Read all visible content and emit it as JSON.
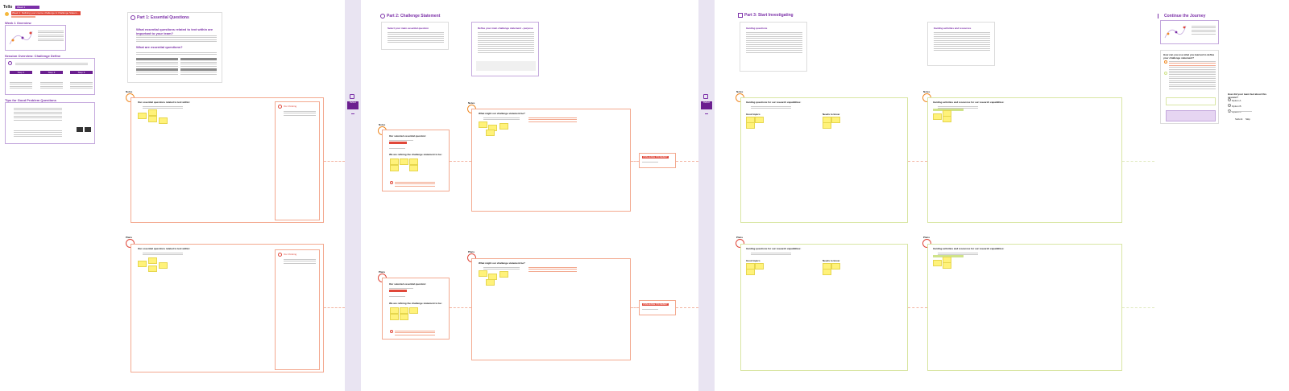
{
  "header": {
    "brand": "Tello",
    "badge": "Week 1",
    "banner": "Week 1: Defining your course challenge & Challenge Statem..."
  },
  "left_panel": {
    "overview_title": "Week 1 Overview",
    "session_title": "Session Overview: Challenge Define",
    "tips_title": "Tips for Good Problem Questions",
    "steps": [
      "Step 1",
      "Step 2",
      "Step 3"
    ]
  },
  "part1": {
    "title": "Part 1: Essential Questions",
    "q1": "What essential questions related to text within are important to your team?",
    "q2": "What are essential questions?",
    "table_headers": [
      "",
      "",
      "",
      ""
    ],
    "row_top_label": "Notes",
    "row_bottom_label": "Plans",
    "prompt_top": "Our essential questions related to text within:",
    "prompt_bottom": "Our essential questions related to text within:",
    "side_title_top": "Our thinking",
    "side_title_bottom": "Our thinking"
  },
  "divider1": {
    "label": "Reflect"
  },
  "part2": {
    "title": "Part 2: Challenge Statement",
    "card1_title": "Select your main essential question",
    "card2_title": "Refine your main challenge statement - purpose",
    "top_label": "Notes",
    "bottom_label": "Plans",
    "mid_top_label": "Notes",
    "prompt_top": "What might our challenge statement be?",
    "prompt_bottom": "What might our challenge statement be?",
    "card_select": "Our selected essential question:",
    "card_select_bottom": "Our selected essential question:",
    "card_stmt": "We are refining the challenge statement to be:",
    "card_stmt_bottom": "We are refining the challenge statement to be:",
    "output_tag_top": "CHALLENGE STATEMENT",
    "output_tag_bottom": "CHALLENGE STATEMENT"
  },
  "divider2": {
    "label": "Reflect"
  },
  "part3": {
    "title": "Part 3: Start Investigating",
    "card1_title": "Guiding questions",
    "card2_title": "Guiding activities and resources",
    "top_label": "Notes",
    "bottom_label": "Plans",
    "prompt_top_left": "Guiding questions for our research capabilities:",
    "prompt_top_right": "Guiding activities and resources for our research capabilities:",
    "prompt_bottom_left": "Guiding questions for our research capabilities:",
    "prompt_bottom_right": "Guiding activities and resources for our research capabilities:",
    "col_left": "Good topics",
    "col_right": "Needs to know"
  },
  "continue": {
    "title": "Continue the Journey",
    "question": "How can you use what you learned to define your challenge statement?",
    "poll_title": "How did your team feel about this session?",
    "poll_options": [
      "Option A",
      "Option B",
      "Option C"
    ],
    "buttons": [
      "Submit",
      "Skip"
    ]
  },
  "colors": {
    "purple": "#7b2fa8",
    "orange": "#f08a24",
    "red": "#e0483a",
    "sticky": "#fff27a",
    "divider": "#e9e4f2"
  }
}
